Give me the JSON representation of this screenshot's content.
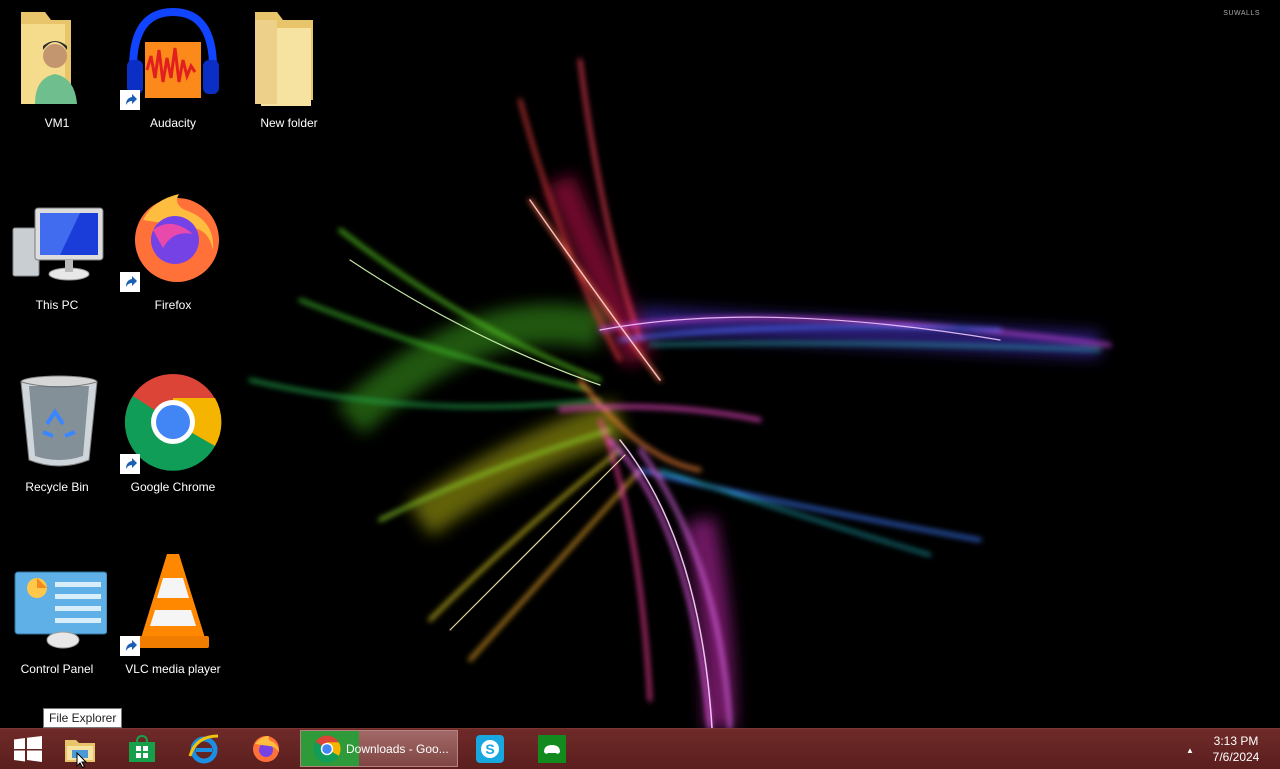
{
  "watermark": "SUWALLS",
  "desktop_icons": [
    {
      "label": "VM1",
      "icon": "folder-user-icon",
      "shortcut": false
    },
    {
      "label": "Audacity",
      "icon": "audacity-icon",
      "shortcut": true
    },
    {
      "label": "New folder",
      "icon": "folder-icon",
      "shortcut": false
    },
    {
      "label": "This PC",
      "icon": "this-pc-icon",
      "shortcut": false
    },
    {
      "label": "Firefox",
      "icon": "firefox-icon",
      "shortcut": true
    },
    {
      "label": "Recycle Bin",
      "icon": "recycle-bin-icon",
      "shortcut": false
    },
    {
      "label": "Google Chrome",
      "icon": "chrome-icon",
      "shortcut": true
    },
    {
      "label": "Control Panel",
      "icon": "control-panel-icon",
      "shortcut": false
    },
    {
      "label": "VLC media player",
      "icon": "vlc-icon",
      "shortcut": true
    }
  ],
  "taskbar": {
    "start": "windows-logo-icon",
    "pinned": [
      "file-explorer-icon",
      "store-icon",
      "internet-explorer-icon",
      "firefox-icon",
      "skype-icon",
      "xbox-icon"
    ],
    "active_window_title": "Downloads - Goo...",
    "active_window_icon": "chrome-icon",
    "tray_arrow": "▲",
    "clock_time": "3:13 PM",
    "clock_date": "7/6/2024",
    "color": "#5b1f1e"
  },
  "tooltip": "File Explorer"
}
